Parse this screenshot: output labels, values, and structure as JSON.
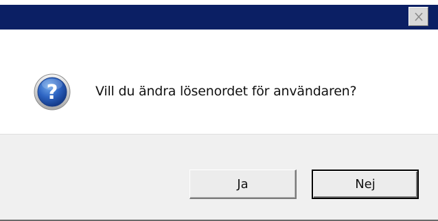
{
  "window": {
    "title": "",
    "close_icon": "close-x-icon"
  },
  "message": {
    "icon": "question-icon",
    "text": "Vill du ändra lösenordet för användaren?"
  },
  "buttons": {
    "yes_label": "Ja",
    "no_label": "Nej"
  },
  "colors": {
    "titlebar": "#0b1f64",
    "icon_blue": "#1a4fa8",
    "footer": "#f0f0f0"
  }
}
